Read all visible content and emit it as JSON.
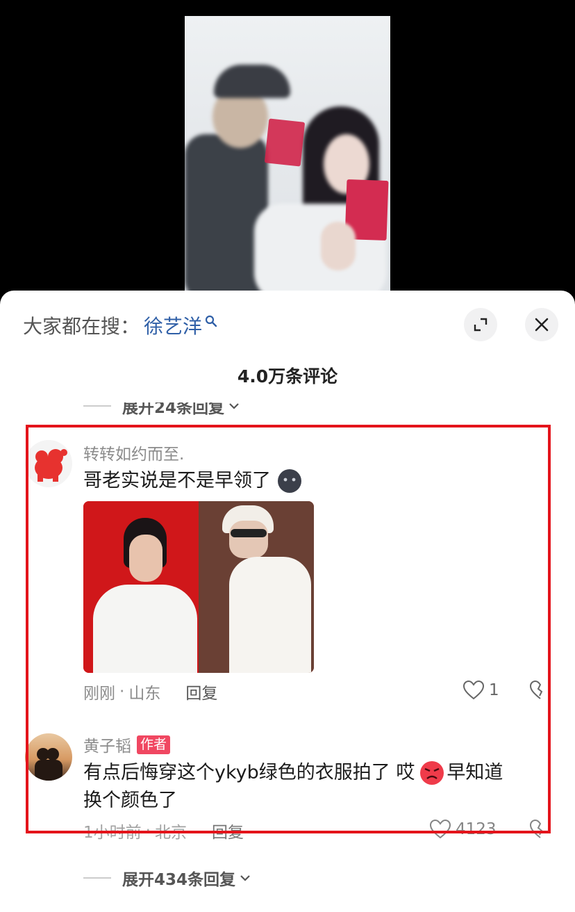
{
  "search": {
    "prefix": "大家都在搜：",
    "term": "徐艺洋"
  },
  "header": {
    "comment_count": "4.0万条评论"
  },
  "previous_expand": {
    "label": "展开24条回复"
  },
  "comments": [
    {
      "username": "转转如约而至.",
      "text": "哥老实说是不是早领了",
      "time": "刚刚",
      "location": "山东",
      "reply_label": "回复",
      "like_count": "1"
    },
    {
      "username": "黄子韬",
      "badge": "作者",
      "text_line1": "有点后悔穿这个ykyb绿色的衣服拍了 哎",
      "text_line1_tail": "早知道",
      "text_line2": "换个颜色了",
      "time": "1小时前",
      "location": "北京",
      "reply_label": "回复",
      "like_count": "4123"
    }
  ],
  "expand": {
    "label": "展开434条回复"
  },
  "colors": {
    "highlight": "#e4141b",
    "search_term": "#2f5fa7",
    "author_badge": "#f04761"
  }
}
